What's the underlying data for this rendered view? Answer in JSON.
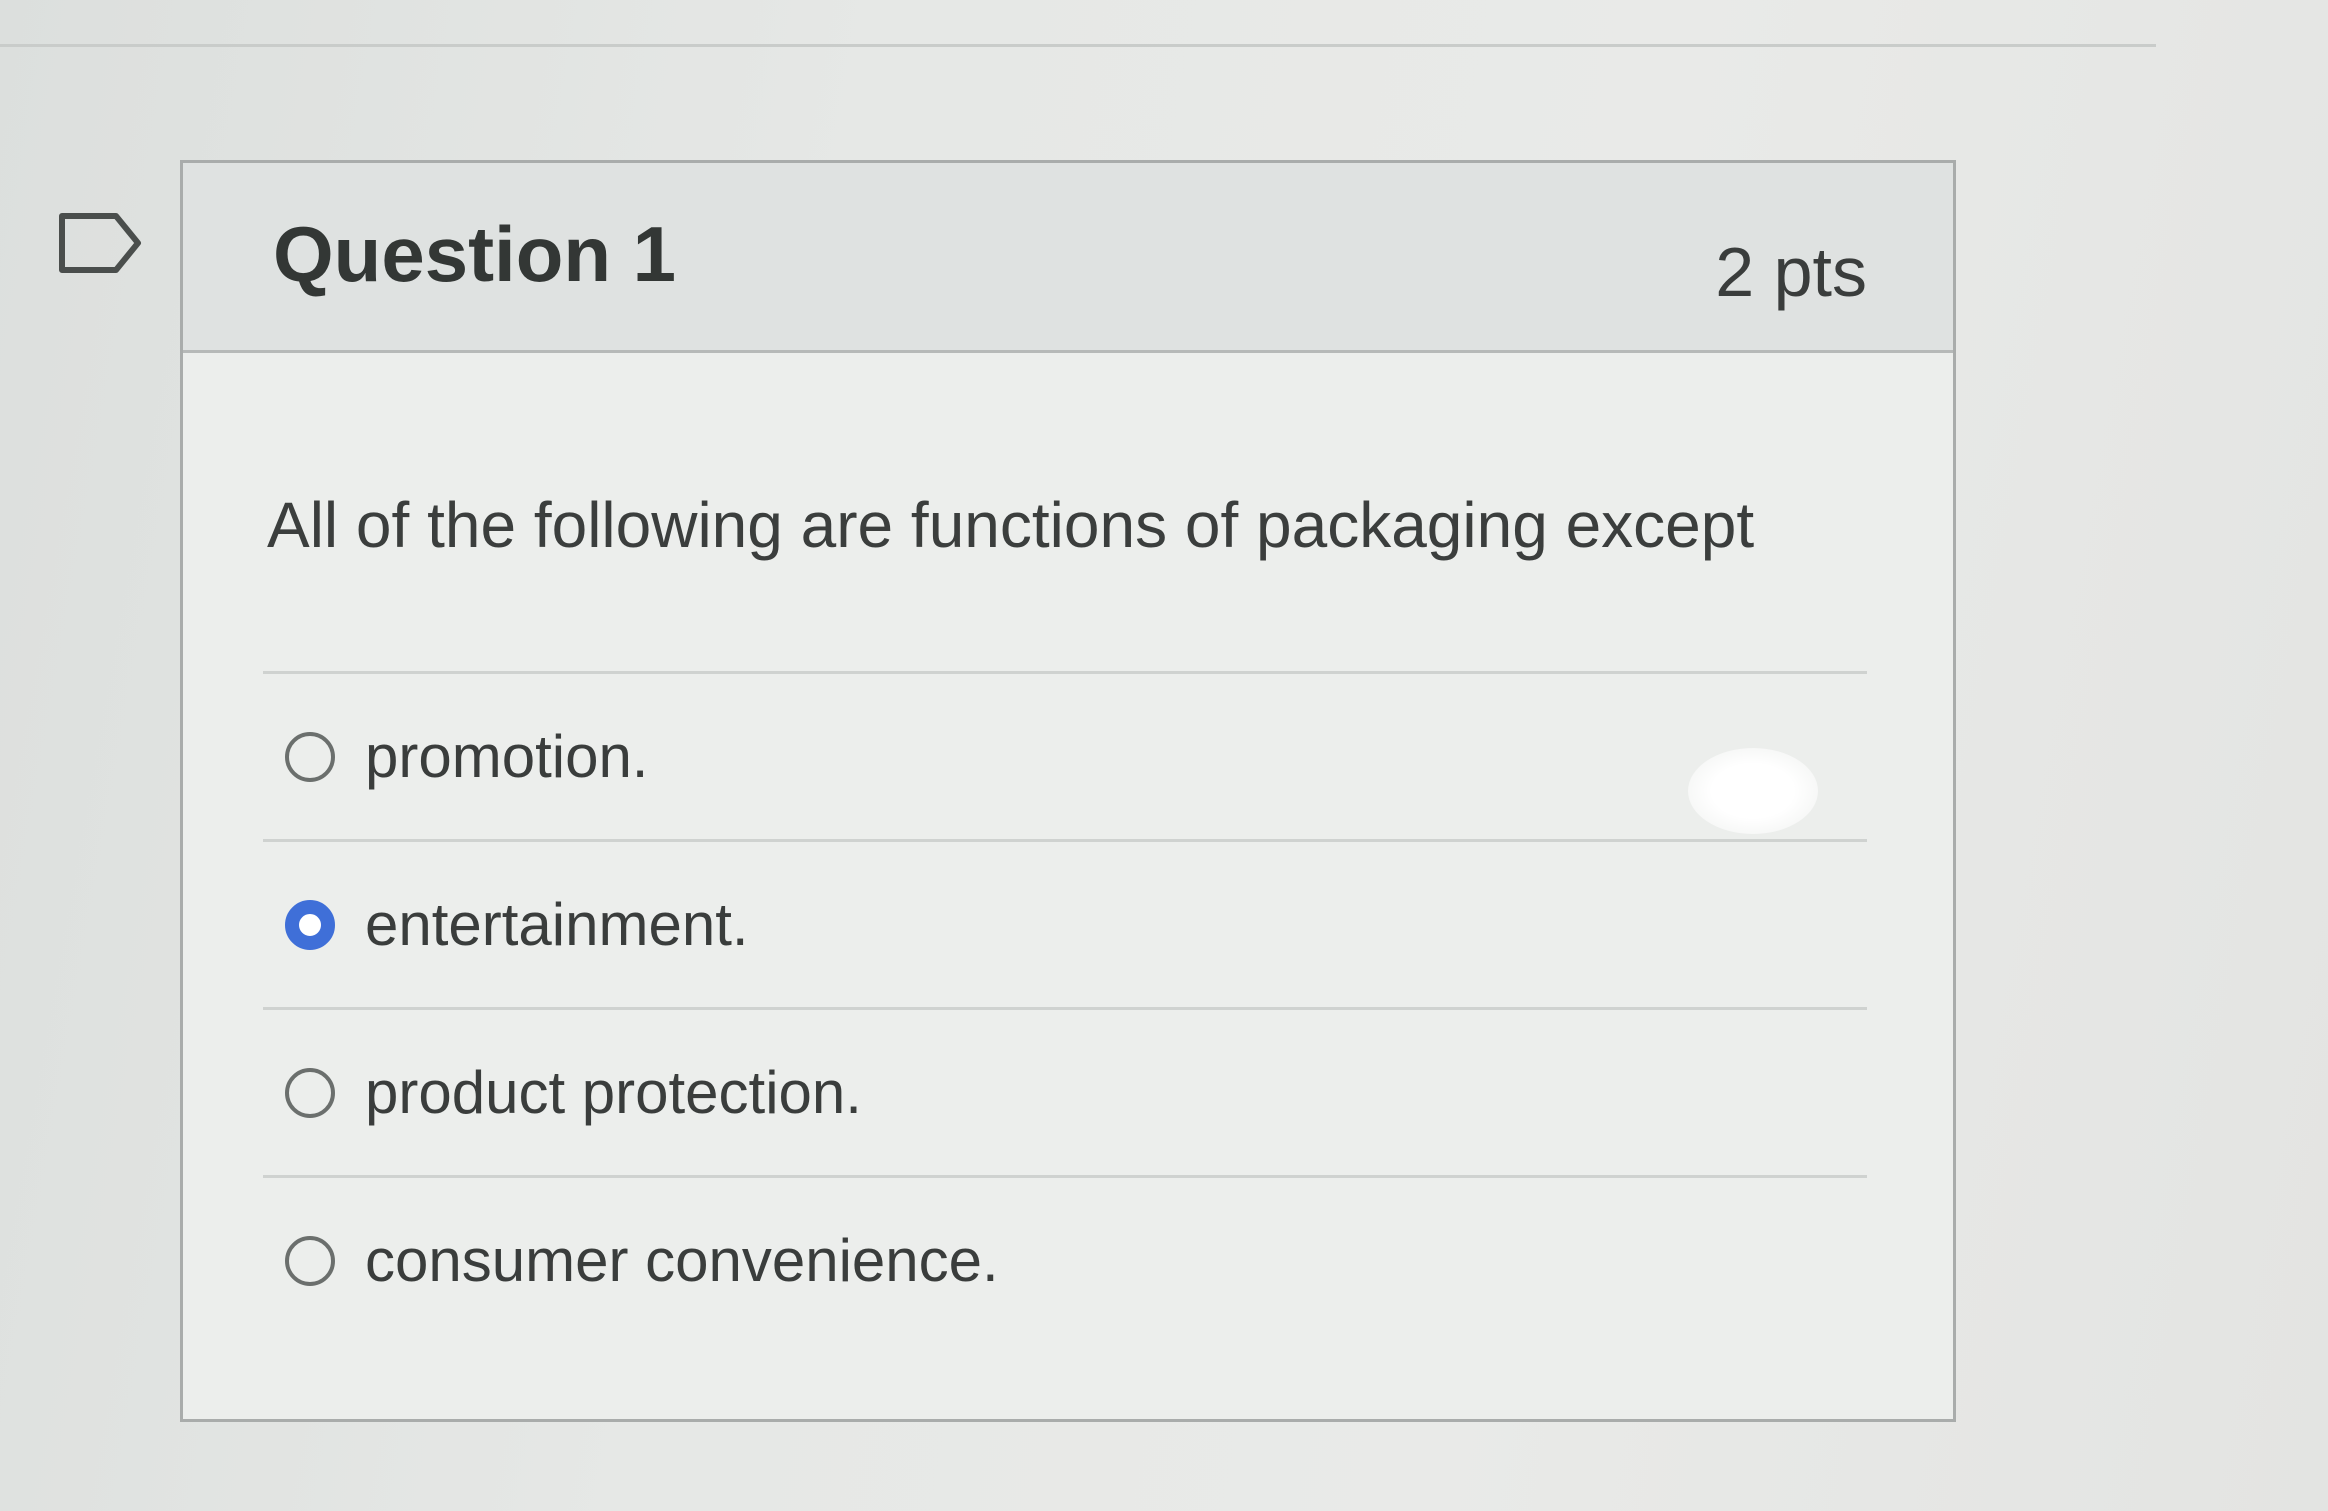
{
  "question": {
    "title": "Question 1",
    "points": "2 pts",
    "text": "All of the following are functions of packaging except"
  },
  "answers": [
    {
      "label": "promotion.",
      "selected": false
    },
    {
      "label": "entertainment.",
      "selected": true
    },
    {
      "label": "product protection.",
      "selected": false
    },
    {
      "label": "consumer convenience.",
      "selected": false
    }
  ],
  "colors": {
    "selected_radio": "#3f6fd8",
    "header_bg": "#dfe2e1",
    "card_bg": "#eceeec"
  },
  "icons": {
    "flag": "flag-question-icon"
  }
}
